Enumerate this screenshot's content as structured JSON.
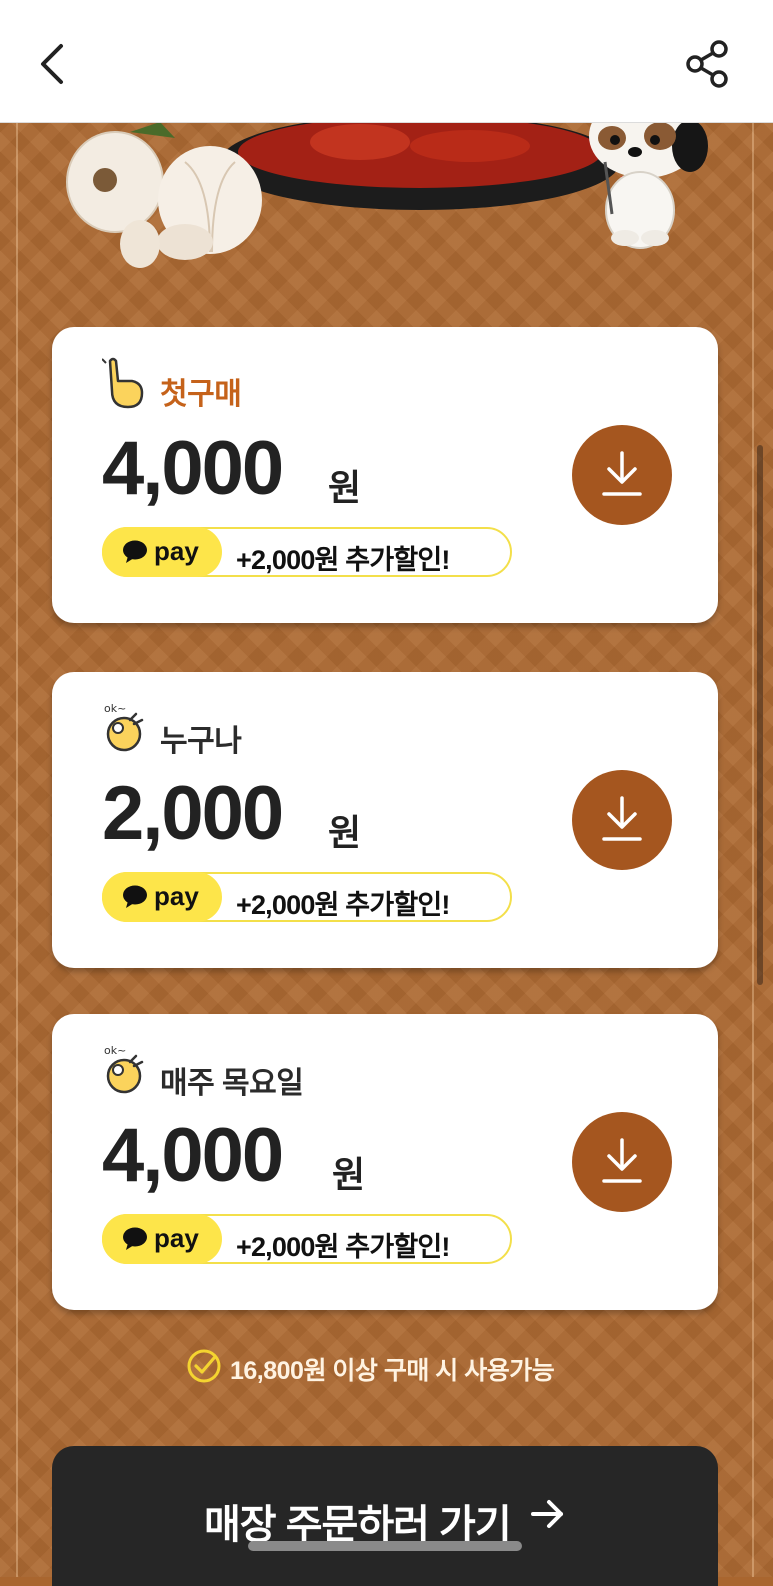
{
  "header": {
    "back_icon": "chevron-left-icon",
    "share_icon": "share-icon"
  },
  "coupons": [
    {
      "label": "첫구매",
      "icon": "pointing-hand-icon",
      "amount": "4,000",
      "unit": "원",
      "pay_label": "pay",
      "pay_extra": "+2,000원 추가할인!",
      "download_icon": "download-icon",
      "label_color": "#c5621a"
    },
    {
      "label": "누구나",
      "icon": "ok-hand-icon",
      "amount": "2,000",
      "unit": "원",
      "pay_label": "pay",
      "pay_extra": "+2,000원 추가할인!",
      "download_icon": "download-icon"
    },
    {
      "label": "매주 목요일",
      "icon": "ok-hand-icon",
      "amount": "4,000",
      "unit": "원",
      "pay_label": "pay",
      "pay_extra": "+2,000원 추가할인!",
      "download_icon": "download-icon"
    }
  ],
  "note": {
    "icon": "check-circle-icon",
    "text": "16,800원 이상 구매 시 사용가능"
  },
  "order_button": {
    "label": "매장 주문하러 가기",
    "icon": "arrow-right-icon"
  },
  "colors": {
    "background": "#ad6a33",
    "download_button": "#a5561f",
    "pay_yellow": "#fde54a",
    "order_button": "#262626"
  }
}
